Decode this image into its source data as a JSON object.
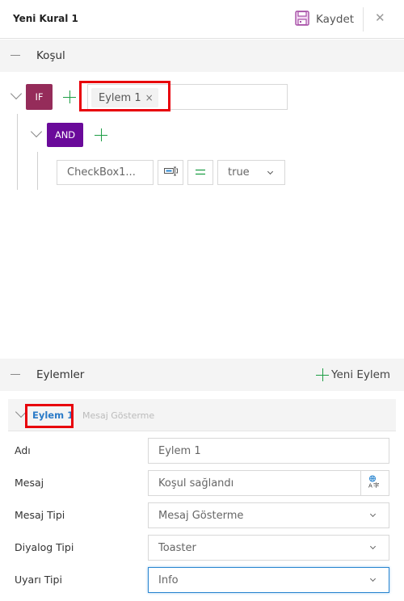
{
  "header": {
    "title": "Yeni Kural 1",
    "save_label": "Kaydet",
    "save_icon": "floppy-disk-icon",
    "close_icon": "close-icon",
    "close_glyph": "✕"
  },
  "condition_section": {
    "title": "Koşul",
    "if_badge": "IF",
    "if_tags": [
      {
        "label": "Eylem 1",
        "remove_glyph": "×"
      }
    ],
    "and_badge": "AND",
    "rule": {
      "field": "CheckBox1...",
      "operator_symbol": "=",
      "value": "true"
    }
  },
  "actions_section": {
    "title": "Eylemler",
    "new_action_label": "Yeni Eylem",
    "action": {
      "name": "Eylem 1",
      "type": "Mesaj Gösterme"
    },
    "form": {
      "name_label": "Adı",
      "name_value": "Eylem 1",
      "message_label": "Mesaj",
      "message_value": "Koşul sağlandı",
      "message_type_label": "Mesaj Tipi",
      "message_type_value": "Mesaj Gösterme",
      "dialog_type_label": "Diyalog Tipi",
      "dialog_type_value": "Toaster",
      "alert_type_label": "Uyarı Tipi",
      "alert_type_value": "Info"
    }
  },
  "colors": {
    "if_badge": "#952c5a",
    "and_badge": "#6a0a9a",
    "plus": "#1e9e45",
    "highlight": "#e8000b",
    "link": "#2a7ac7",
    "save_icon": "#a54ea5"
  }
}
